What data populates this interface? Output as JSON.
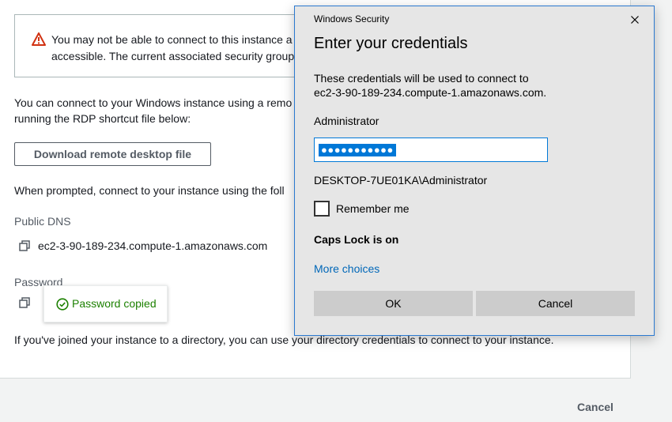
{
  "aws": {
    "alert_text": "You may not be able to connect to this instance a\naccessible. The current associated security group",
    "intro_text": "You can connect to your Windows instance using a remo\nrunning the RDP shortcut file below:",
    "download_button": "Download remote desktop file",
    "prompted_text": "When prompted, connect to your instance using the foll",
    "public_dns_label": "Public DNS",
    "public_dns_value": "ec2-3-90-189-234.compute-1.amazonaws.com",
    "password_label": "Password",
    "copied_tooltip": "Password copied",
    "directory_text": "If you've joined your instance to a directory, you can use your directory credentials to connect to your instance.",
    "cancel_button": "Cancel"
  },
  "dialog": {
    "window_title": "Windows Security",
    "heading": "Enter your credentials",
    "description": "These credentials will be used to connect to\nec2-3-90-189-234.compute-1.amazonaws.com.",
    "username": "Administrator",
    "password_masked": "●●●●●●●●●●●",
    "domain_user": "DESKTOP-7UE01KA\\Administrator",
    "remember_label": "Remember me",
    "remember_checked": false,
    "caps_lock_text": "Caps Lock is on",
    "more_choices": "More choices",
    "ok_button": "OK",
    "cancel_button": "Cancel"
  },
  "colors": {
    "alert_red": "#d13212",
    "success_green": "#1d8102",
    "dialog_accent": "#0078d7",
    "link_blue": "#0067b8"
  },
  "icons": [
    "warning-icon",
    "copy-icon",
    "check-circle-icon",
    "close-icon"
  ]
}
